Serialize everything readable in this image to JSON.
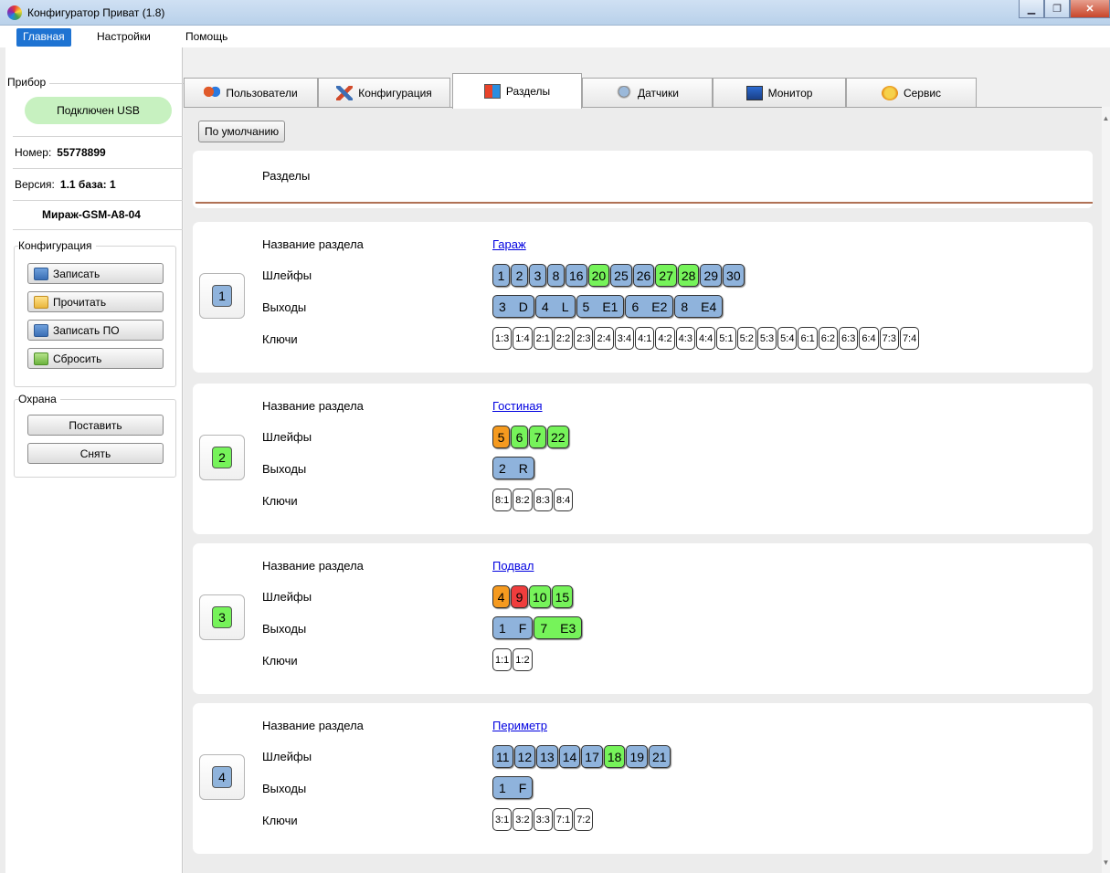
{
  "window": {
    "title": "Конфигуратор Приват (1.8)"
  },
  "menu": [
    "Главная",
    "Настройки",
    "Помощь"
  ],
  "left": {
    "device_label": "Прибор",
    "connection": "Подключен USB",
    "number_label": "Номер:",
    "number_value": "55778899",
    "version_label": "Версия:",
    "version_value": "1.1 база: 1",
    "model": "Мираж-GSM-A8-04",
    "config_label": "Конфигурация",
    "config_buttons": [
      "Записать",
      "Прочитать",
      "Записать ПО",
      "Сбросить"
    ],
    "guard_label": "Охрана",
    "guard_buttons": [
      "Поставить",
      "Снять"
    ]
  },
  "tabs": [
    "Пользователи",
    "Конфигурация",
    "Разделы",
    "Датчики",
    "Монитор",
    "Сервис"
  ],
  "active_tab": "Разделы",
  "content": {
    "default_button": "По умолчанию",
    "header": "Разделы",
    "labels": {
      "name": "Название раздела",
      "loops": "Шлейфы",
      "outputs": "Выходы",
      "keys": "Ключи"
    },
    "sections": [
      {
        "num": "1",
        "num_color": "#8fb3dc",
        "name": "Гараж",
        "loops": [
          {
            "v": "1",
            "s": "blue"
          },
          {
            "v": "2",
            "s": "blue"
          },
          {
            "v": "3",
            "s": "blue"
          },
          {
            "v": "8",
            "s": "blue"
          },
          {
            "v": "16",
            "s": "blue"
          },
          {
            "v": "20",
            "s": "green"
          },
          {
            "v": "25",
            "s": "blue"
          },
          {
            "v": "26",
            "s": "blue"
          },
          {
            "v": "27",
            "s": "green"
          },
          {
            "v": "28",
            "s": "green"
          },
          {
            "v": "29",
            "s": "blue"
          },
          {
            "v": "30",
            "s": "blue"
          }
        ],
        "outputs": [
          {
            "a": "3",
            "b": "D",
            "s": "blue"
          },
          {
            "a": "4",
            "b": "L",
            "s": "blue"
          },
          {
            "a": "5",
            "b": "E1",
            "s": "blue"
          },
          {
            "a": "6",
            "b": "E2",
            "s": "blue"
          },
          {
            "a": "8",
            "b": "E4",
            "s": "blue"
          }
        ],
        "keys": [
          "1:3",
          "1:4",
          "2:1",
          "2:2",
          "2:3",
          "2:4",
          "3:4",
          "4:1",
          "4:2",
          "4:3",
          "4:4",
          "5:1",
          "5:2",
          "5:3",
          "5:4",
          "6:1",
          "6:2",
          "6:3",
          "6:4",
          "7:3",
          "7:4"
        ]
      },
      {
        "num": "2",
        "num_color": "#76f35a",
        "name": "Гостиная",
        "loops": [
          {
            "v": "5",
            "s": "orange"
          },
          {
            "v": "6",
            "s": "green"
          },
          {
            "v": "7",
            "s": "green"
          },
          {
            "v": "22",
            "s": "green"
          }
        ],
        "outputs": [
          {
            "a": "2",
            "b": "R",
            "s": "blue"
          }
        ],
        "keys": [
          "8:1",
          "8:2",
          "8:3",
          "8:4"
        ]
      },
      {
        "num": "3",
        "num_color": "#76f35a",
        "name": "Подвал",
        "loops": [
          {
            "v": "4",
            "s": "orange"
          },
          {
            "v": "9",
            "s": "red"
          },
          {
            "v": "10",
            "s": "green"
          },
          {
            "v": "15",
            "s": "green"
          }
        ],
        "outputs": [
          {
            "a": "1",
            "b": "F",
            "s": "blue"
          },
          {
            "a": "7",
            "b": "E3",
            "s": "green"
          }
        ],
        "keys": [
          "1:1",
          "1:2"
        ]
      },
      {
        "num": "4",
        "num_color": "#8fb3dc",
        "name": "Периметр",
        "loops": [
          {
            "v": "11",
            "s": "blue"
          },
          {
            "v": "12",
            "s": "blue"
          },
          {
            "v": "13",
            "s": "blue"
          },
          {
            "v": "14",
            "s": "blue"
          },
          {
            "v": "17",
            "s": "blue"
          },
          {
            "v": "18",
            "s": "green"
          },
          {
            "v": "19",
            "s": "blue"
          },
          {
            "v": "21",
            "s": "blue"
          }
        ],
        "outputs": [
          {
            "a": "1",
            "b": "F",
            "s": "blue"
          }
        ],
        "keys": [
          "3:1",
          "3:2",
          "3:3",
          "7:1",
          "7:2"
        ]
      }
    ]
  }
}
